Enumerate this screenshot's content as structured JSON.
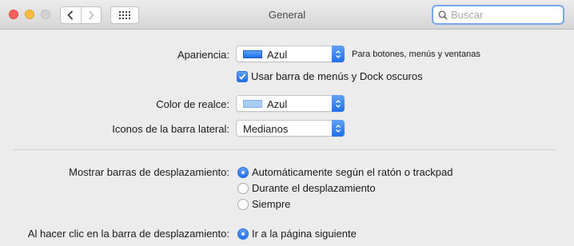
{
  "window": {
    "title": "General",
    "search": {
      "placeholder": "Buscar",
      "value": ""
    }
  },
  "appearance": {
    "label": "Apariencia:",
    "selected": "Azul",
    "swatch_color": "#1f6fee",
    "hint": "Para botones, menús y ventanas",
    "dark_menu_checkbox": {
      "label": "Usar barra de menús y Dock oscuros",
      "checked": true
    }
  },
  "highlight": {
    "label": "Color de realce:",
    "selected": "Azul",
    "swatch_color": "#a8ccf6"
  },
  "sidebar_icons": {
    "label": "Iconos de la barra lateral:",
    "selected": "Medianos"
  },
  "scrollbars": {
    "label": "Mostrar barras de desplazamiento:",
    "options": [
      {
        "label": "Automáticamente según el ratón o trackpad",
        "selected": true
      },
      {
        "label": "Durante el desplazamiento",
        "selected": false
      },
      {
        "label": "Siempre",
        "selected": false
      }
    ]
  },
  "click_scrollbar": {
    "label": "Al hacer clic en la barra de desplazamiento:",
    "options": [
      {
        "label": "Ir a la página siguiente",
        "selected": true
      }
    ]
  },
  "colors": {
    "accent": "#1f6fee",
    "search_focus": "#77a6f0",
    "close": "#fc605c",
    "minimize": "#fdbc40",
    "zoom_disabled": "#d3d3d3"
  }
}
